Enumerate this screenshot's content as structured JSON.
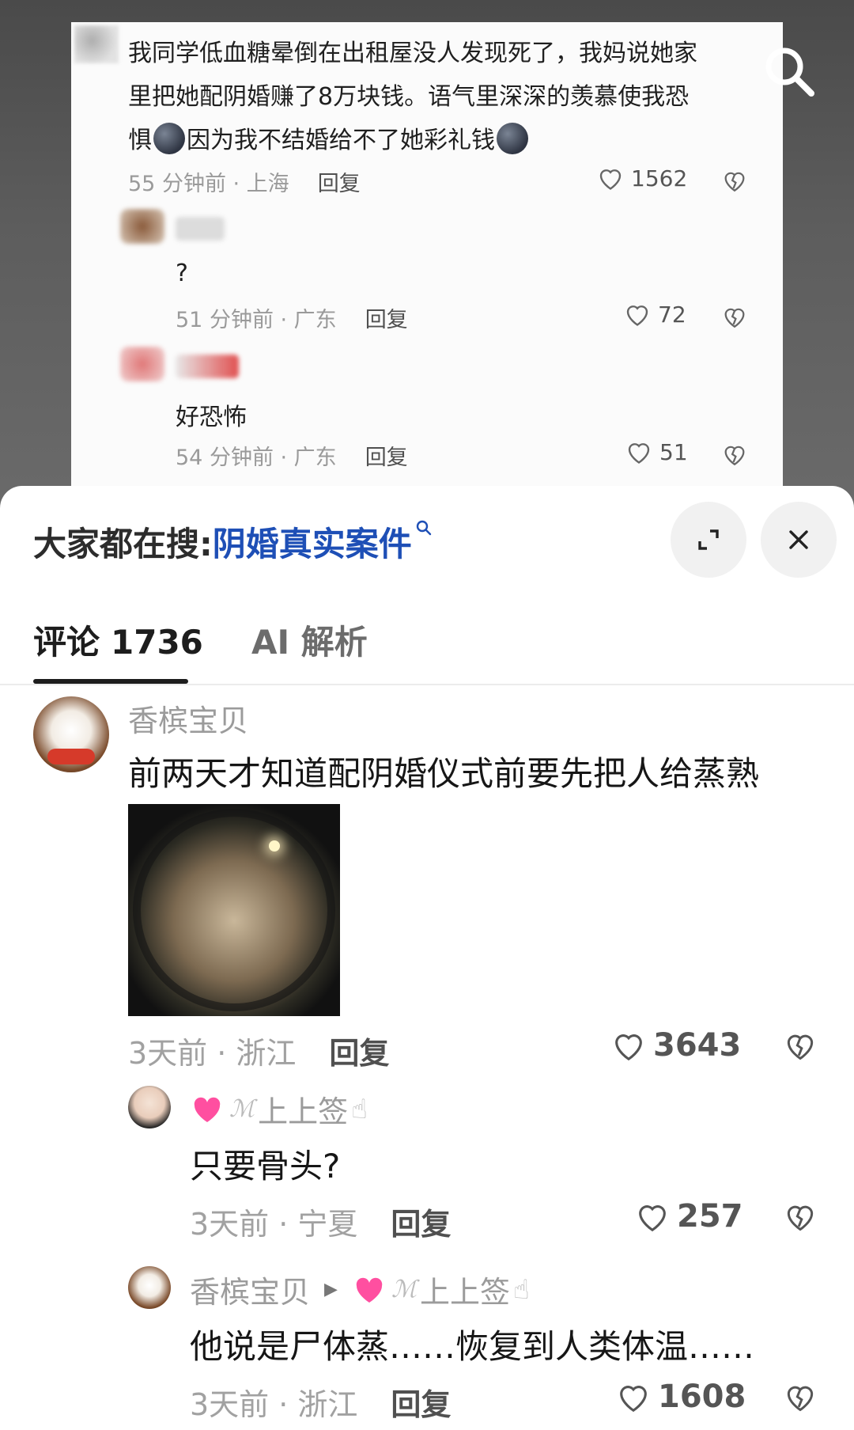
{
  "original_post": {
    "text_lines": [
      "我同学低血糖晕倒在出租屋没人发现死了，我妈说她家",
      "里把她配阴婚赚了8万块钱。语气里深深的羡慕使我恐",
      "惧",
      "因为我不结婚给不了她彩礼钱"
    ],
    "meta": "55 分钟前 · 上海",
    "reply_label": "回复",
    "likes": "1562"
  },
  "original_replies": [
    {
      "text": "?",
      "meta": "51 分钟前 · 广东",
      "reply_label": "回复",
      "likes": "72"
    },
    {
      "text": "好恐怖",
      "meta": "54 分钟前 · 广东",
      "reply_label": "回复",
      "likes": "51"
    }
  ],
  "hot_search": {
    "label": "大家都在搜:",
    "term": "阴婚真实案件"
  },
  "tabs": {
    "comments_label": "评论",
    "comments_count": "1736",
    "ai_label": "AI 解析"
  },
  "comments": [
    {
      "name": "香槟宝贝",
      "text": "前两天才知道配阴婚仪式前要先把人给蒸熟",
      "meta": "3天前 · 浙江",
      "reply_label": "回复",
      "likes": "3643"
    },
    {
      "name": "上上签",
      "text": "只要骨头?",
      "meta": "3天前 · 宁夏",
      "reply_label": "回复",
      "likes": "257"
    },
    {
      "name": "香槟宝贝",
      "reply_to": "上上签",
      "text": "他说是尸体蒸……恢复到人类体温……",
      "meta": "3天前 · 浙江",
      "reply_label": "回复",
      "likes": "1608"
    }
  ],
  "colors": {
    "accent_blue": "#1e4fb6",
    "heart_badge": "#ff4fa0"
  }
}
